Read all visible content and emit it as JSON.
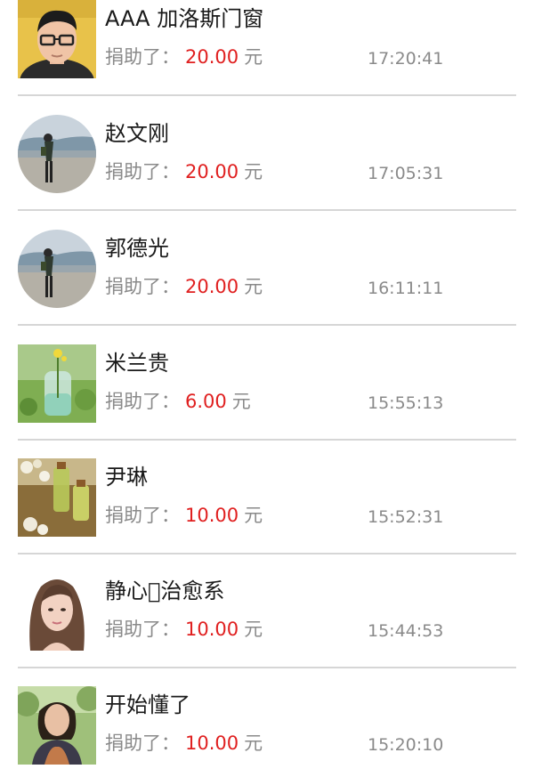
{
  "donations": [
    {
      "name": "AAA 加洛斯门窗",
      "label": "捐助了：",
      "amount": "20.00",
      "unit": "元",
      "time": "17:20:41",
      "avatar": "photo-man-glasses-avatar"
    },
    {
      "name": "赵文刚",
      "label": "捐助了：",
      "amount": "20.00",
      "unit": "元",
      "time": "17:05:31",
      "avatar": "photo-beach-figure-avatar"
    },
    {
      "name": "郭德光",
      "label": "捐助了：",
      "amount": "20.00",
      "unit": "元",
      "time": "16:11:11",
      "avatar": "photo-beach-figure-avatar"
    },
    {
      "name": "米兰贵",
      "label": "捐助了：",
      "amount": "6.00",
      "unit": "元",
      "time": "15:55:13",
      "avatar": "photo-flower-vase-avatar"
    },
    {
      "name": "尹琳",
      "label": "捐助了：",
      "amount": "10.00",
      "unit": "元",
      "time": "15:52:31",
      "avatar": "photo-bottles-flowers-avatar"
    },
    {
      "name": "静心\u0000治愈系",
      "label": "捐助了：",
      "amount": "10.00",
      "unit": "元",
      "time": "15:44:53",
      "avatar": "photo-woman-portrait-avatar"
    },
    {
      "name": "开始懂了",
      "label": "捐助了：",
      "amount": "10.00",
      "unit": "元",
      "time": "15:20:10",
      "avatar": "photo-woman-outdoor-avatar"
    }
  ],
  "colors": {
    "amount": "#e02020",
    "muted": "#8a8a8a",
    "name": "#1a1a1a",
    "divider": "#d6d6d6"
  }
}
